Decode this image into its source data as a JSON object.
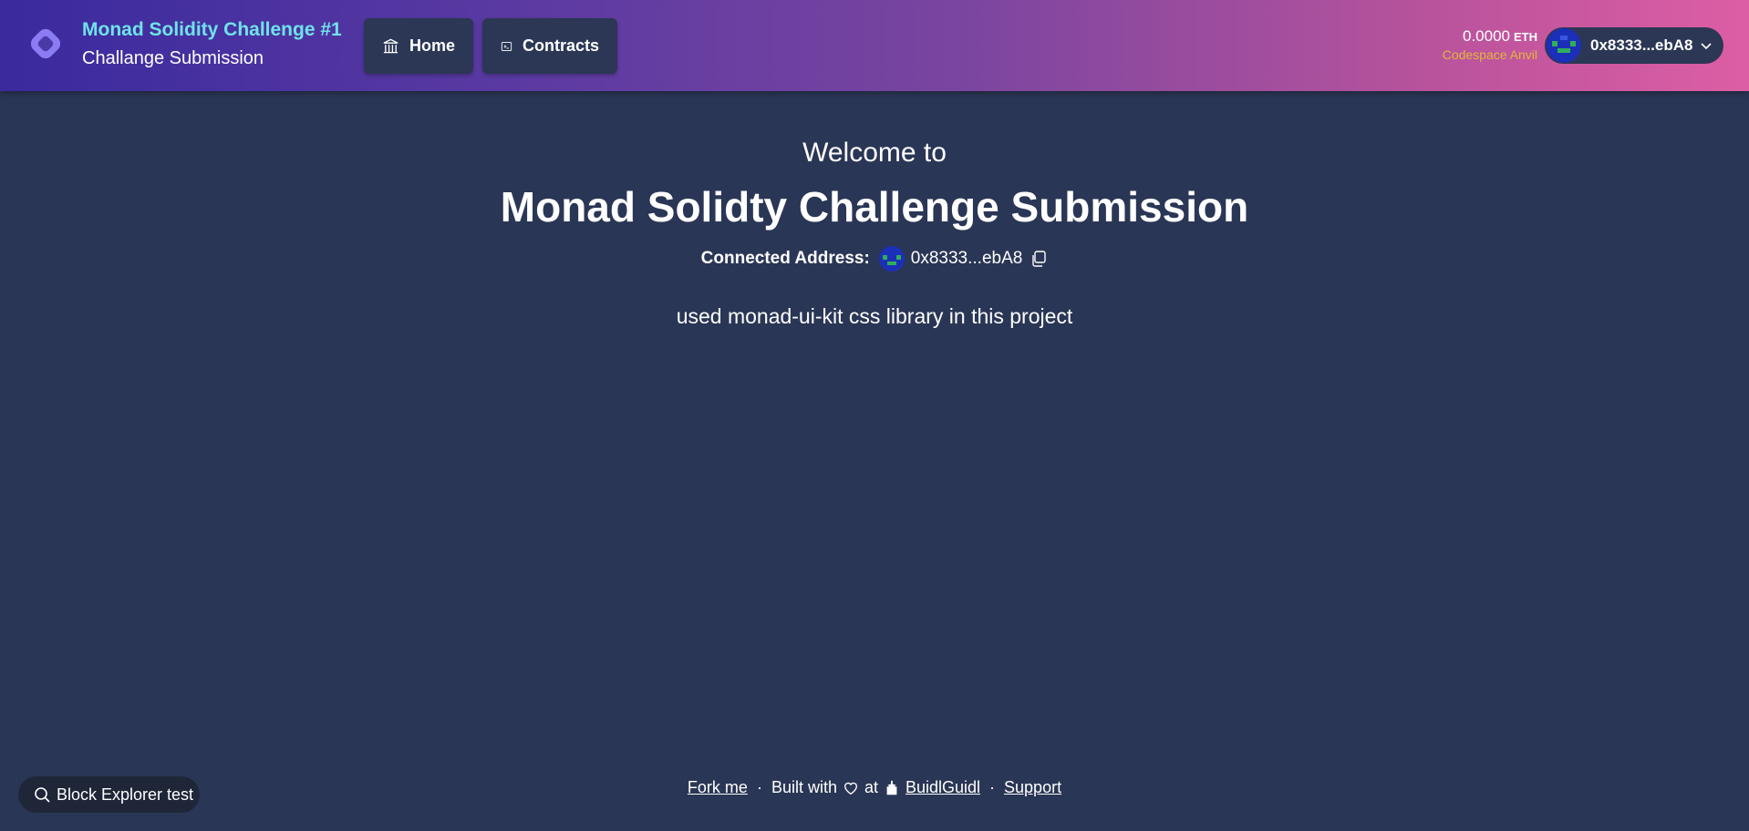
{
  "header": {
    "title": "Monad Solidity Challenge #1",
    "subtitle": "Challange Submission",
    "logo_icon": "diamond-logo-icon",
    "nav": [
      {
        "label": "Home",
        "icon": "bank-icon"
      },
      {
        "label": "Contracts",
        "icon": "terminal-icon"
      }
    ],
    "balance": {
      "amount": "0.0000",
      "unit": "ETH"
    },
    "network": "Codespace Anvil",
    "account": {
      "address": "0x8333...ebA8",
      "icon": "blockie-avatar-icon"
    }
  },
  "main": {
    "welcome": "Welcome to",
    "title": "Monad Solidty Challenge Submission",
    "connected_label": "Connected Address:",
    "connected_address": "0x8333...ebA8",
    "description": "used monad-ui-kit css library in this project"
  },
  "block_explorer": {
    "label": "Block Explorer test",
    "icon": "search-icon"
  },
  "footer": {
    "fork": "Fork me",
    "sep": "·",
    "built_with": "Built with",
    "at": "at",
    "buidlguidl": "BuidlGuidl",
    "support": "Support"
  },
  "colors": {
    "background": "#2a3655",
    "accent_title": "#6fe3e9",
    "network": "#e2b53a",
    "button_bg": "#2b3754"
  }
}
